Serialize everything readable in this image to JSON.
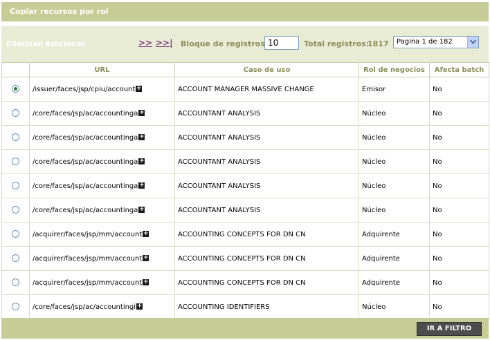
{
  "header": {
    "title": "Copiar recursos por rol"
  },
  "toolbar": {
    "delete_label": "Eliminar",
    "separator": "|",
    "add_label": "Adicionar",
    "next_label": ">>",
    "last_label": ">>|",
    "block_label": "Bloque de registros:",
    "block_value": "10",
    "total_label": "Total registros:",
    "total_value": "1817",
    "page_select": "Pagina 1 de 182"
  },
  "table": {
    "columns": [
      "",
      "URL",
      "Caso de uso",
      "Rol de negocios",
      "Afecta batch"
    ],
    "rows": [
      {
        "selected": true,
        "url": "/issuer/faces/jsp/cpiu/account",
        "use_case": "ACCOUNT MANAGER MASSIVE CHANGE",
        "role": "Emisor",
        "batch": "No"
      },
      {
        "selected": false,
        "url": "/core/faces/jsp/ac/accountinga",
        "use_case": "ACCOUNTANT ANALYSIS",
        "role": "Núcleo",
        "batch": "No"
      },
      {
        "selected": false,
        "url": "/core/faces/jsp/ac/accountinga",
        "use_case": "ACCOUNTANT ANALYSIS",
        "role": "Núcleo",
        "batch": "No"
      },
      {
        "selected": false,
        "url": "/core/faces/jsp/ac/accountinga",
        "use_case": "ACCOUNTANT ANALYSIS",
        "role": "Núcleo",
        "batch": "No"
      },
      {
        "selected": false,
        "url": "/core/faces/jsp/ac/accountinga",
        "use_case": "ACCOUNTANT ANALYSIS",
        "role": "Núcleo",
        "batch": "No"
      },
      {
        "selected": false,
        "url": "/core/faces/jsp/ac/accountinga",
        "use_case": "ACCOUNTANT ANALYSIS",
        "role": "Núcleo",
        "batch": "No"
      },
      {
        "selected": false,
        "url": "/acquirer/faces/jsp/mm/account",
        "use_case": "ACCOUNTING CONCEPTS FOR DN CN",
        "role": "Adquirente",
        "batch": "No"
      },
      {
        "selected": false,
        "url": "/acquirer/faces/jsp/mm/account",
        "use_case": "ACCOUNTING CONCEPTS FOR DN CN",
        "role": "Adquirente",
        "batch": "No"
      },
      {
        "selected": false,
        "url": "/acquirer/faces/jsp/mm/account",
        "use_case": "ACCOUNTING CONCEPTS FOR DN CN",
        "role": "Adquirente",
        "batch": "No"
      },
      {
        "selected": false,
        "url": "/core/faces/jsp/ac/accountingi",
        "use_case": "ACCOUNTING IDENTIFIERS",
        "role": "Núcleo",
        "batch": "No"
      }
    ]
  },
  "footer": {
    "filter_button": "IR A FILTRO"
  },
  "icons": {
    "expand": "plus-icon",
    "select_arrow": "chevron-down-icon"
  },
  "colors": {
    "title_bar": "#c6cc96",
    "toolbar": "#e8ecd4",
    "header_text": "#8a8e5a",
    "button": "#4d4d4d"
  }
}
